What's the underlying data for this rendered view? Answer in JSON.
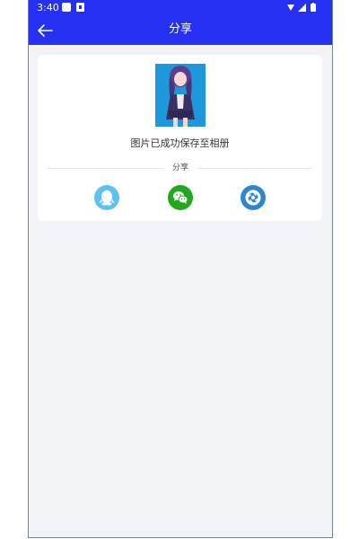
{
  "status_bar": {
    "time": "3:40"
  },
  "header": {
    "title": "分享",
    "back_icon": "arrow-left-icon"
  },
  "card": {
    "saved_message": "图片已成功保存至相册",
    "share_label": "分享",
    "share_targets": [
      {
        "icon": "qq-icon",
        "color": "#5bc2f1"
      },
      {
        "icon": "wechat-icon",
        "color": "#21a81f"
      },
      {
        "icon": "moments-icon",
        "color": "#2f86cf"
      }
    ]
  },
  "colors": {
    "topbar": "#2630f2",
    "page_background": "#f2f3f7",
    "card_background": "#ffffff"
  }
}
